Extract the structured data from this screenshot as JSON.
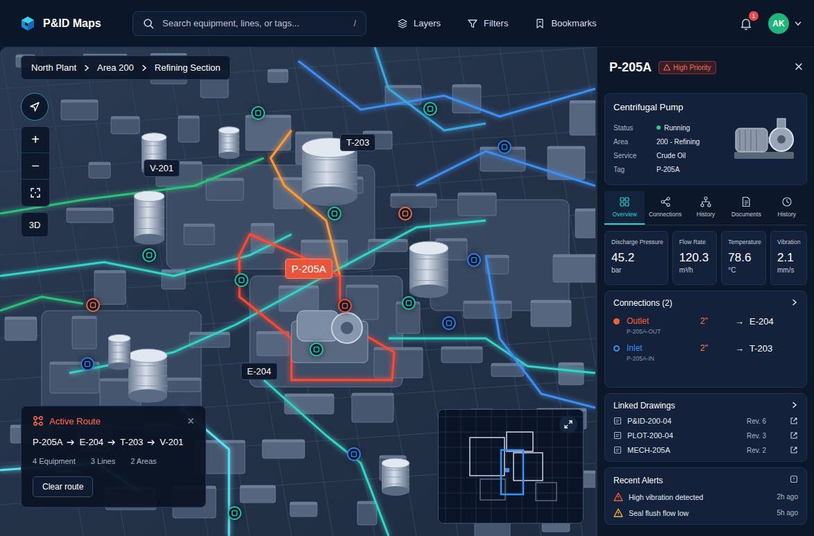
{
  "app": {
    "title": "P&ID Maps"
  },
  "search": {
    "placeholder": "Search equipment, lines, or tags...",
    "shortcut": "/"
  },
  "nav": [
    {
      "label": "Layers"
    },
    {
      "label": "Filters"
    },
    {
      "label": "Bookmarks"
    }
  ],
  "notifications": {
    "count": "1"
  },
  "user": {
    "initials": "AK"
  },
  "breadcrumb": [
    "North Plant",
    "Area 200",
    "Refining Section"
  ],
  "map_controls": {
    "zoom_in": "+",
    "zoom_out": "−",
    "mode": "3D"
  },
  "map": {
    "labels": [
      {
        "text": "T-203",
        "selected": false
      },
      {
        "text": "V-201",
        "selected": false
      },
      {
        "text": "P-205A",
        "selected": true
      },
      {
        "text": "E-204",
        "selected": false
      }
    ],
    "pins": [
      {
        "color": "#1fc7a6"
      },
      {
        "color": "#1fc7a6"
      },
      {
        "color": "#2f7fe8"
      },
      {
        "color": "#1fc7a6"
      },
      {
        "color": "#f06a3a"
      },
      {
        "color": "#1fc7a6"
      },
      {
        "color": "#2f7fe8"
      },
      {
        "color": "#1fc7a6"
      },
      {
        "color": "#1fc7a6"
      },
      {
        "color": "#2f7fe8"
      },
      {
        "color": "#1fc7a6"
      },
      {
        "color": "#f06a3a"
      },
      {
        "color": "#2f7fe8"
      },
      {
        "color": "#2f7fe8"
      },
      {
        "color": "#1fc7a6"
      },
      {
        "color": "#f0503a"
      }
    ]
  },
  "route": {
    "title": "Active Route",
    "steps": [
      "P-205A",
      "E-204",
      "T-203",
      "V-201"
    ],
    "stats": [
      "4 Equipment",
      "3 Lines",
      "2 Areas"
    ],
    "button": "Clear route"
  },
  "panel": {
    "title": "P-205A",
    "priority": "High Priority",
    "equipment": {
      "type": "Centrifugal Pump",
      "fields": [
        {
          "label": "Status",
          "value": "Running",
          "color": "#2ad17e"
        },
        {
          "label": "Area",
          "value": "200 - Refining"
        },
        {
          "label": "Service",
          "value": "Crude Oil"
        },
        {
          "label": "Tag",
          "value": "P-205A"
        }
      ]
    },
    "tabs": [
      {
        "label": "Overview",
        "selected": true
      },
      {
        "label": "Connections",
        "selected": false
      },
      {
        "label": "History",
        "selected": false
      },
      {
        "label": "Documents",
        "selected": false
      },
      {
        "label": "History",
        "selected": false
      }
    ],
    "metrics": [
      {
        "label": "Discharge Pressure",
        "value": "45.2",
        "unit": "bar"
      },
      {
        "label": "Flow Rate",
        "value": "120.3",
        "unit": "m³/h"
      },
      {
        "label": "Temperature",
        "value": "78.6",
        "unit": "°C"
      },
      {
        "label": "Vibration",
        "value": "2.1",
        "unit": "mm/s"
      }
    ],
    "connections": {
      "title": "Connections (2)",
      "items": [
        {
          "direction": "Outlet",
          "line": "P-205A-OUT",
          "size": "2\"",
          "arrow": "→",
          "target": "E-204",
          "color": "#f0603a"
        },
        {
          "direction": "Inlet",
          "line": "P-205A-IN",
          "size": "2\"",
          "arrow": "→",
          "target": "T-203",
          "color": "#3f8ef0"
        }
      ]
    },
    "drawings": {
      "title": "Linked Drawings",
      "items": [
        {
          "name": "P&ID-200-04",
          "rev": "Rev. 6"
        },
        {
          "name": "PLOT-200-04",
          "rev": "Rev. 3"
        },
        {
          "name": "MECH-205A",
          "rev": "Rev. 2"
        }
      ]
    },
    "alerts": {
      "title": "Recent Alerts",
      "items": [
        {
          "text": "High vibration detected",
          "time": "2h ago",
          "color": "#f0603a"
        },
        {
          "text": "Seal flush flow low",
          "time": "5h ago",
          "color": "#f0b43a"
        }
      ]
    }
  }
}
